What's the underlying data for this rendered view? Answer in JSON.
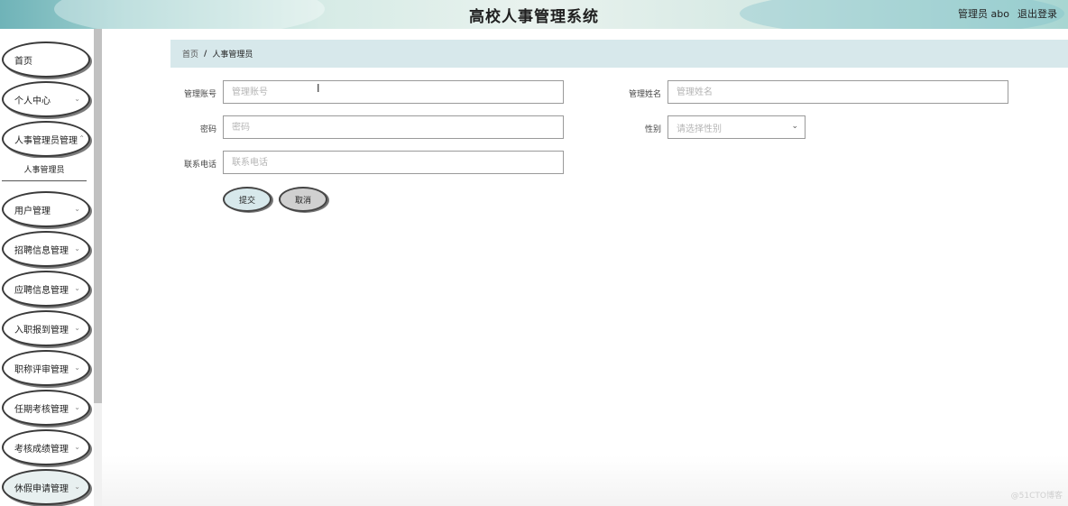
{
  "header": {
    "title": "高校人事管理系统",
    "user": "管理员 abo",
    "logout": "退出登录"
  },
  "sidebar": {
    "items": [
      {
        "label": "首页"
      },
      {
        "label": "个人中心"
      },
      {
        "label": "人事管理员管理"
      },
      {
        "label": "用户管理"
      },
      {
        "label": "招聘信息管理"
      },
      {
        "label": "应聘信息管理"
      },
      {
        "label": "入职报到管理"
      },
      {
        "label": "职称评审管理"
      },
      {
        "label": "任期考核管理"
      },
      {
        "label": "考核成绩管理"
      },
      {
        "label": "休假申请管理"
      }
    ],
    "submenu": "人事管理员"
  },
  "breadcrumb": {
    "home": "首页",
    "separator": "/",
    "current": "人事管理员"
  },
  "form": {
    "account_label": "管理账号",
    "account_placeholder": "管理账号",
    "name_label": "管理姓名",
    "name_placeholder": "管理姓名",
    "password_label": "密码",
    "password_placeholder": "密码",
    "gender_label": "性别",
    "gender_placeholder": "请选择性别",
    "phone_label": "联系电话",
    "phone_placeholder": "联系电话",
    "submit": "提交",
    "cancel": "取消"
  },
  "watermark": "@51CTO博客",
  "icons": {
    "chevron": "chevron-down-icon",
    "cursor": "text-cursor-icon"
  }
}
